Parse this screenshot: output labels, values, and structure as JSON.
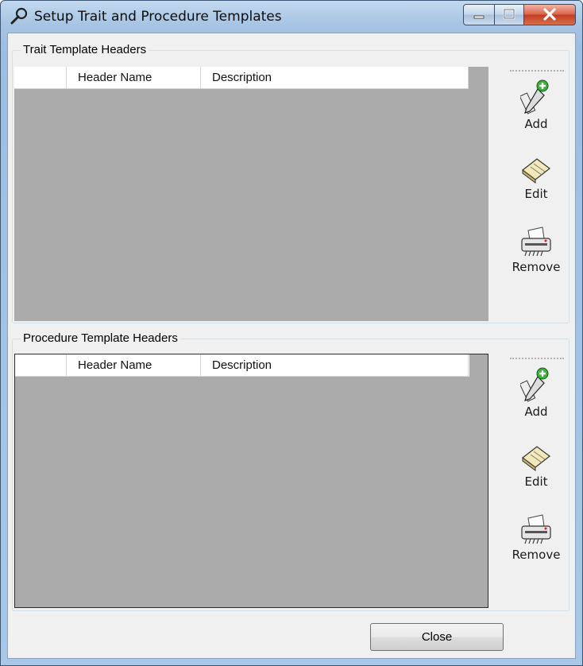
{
  "window": {
    "title": "Setup Trait and Procedure Templates",
    "icons": {
      "app": "wrench-icon",
      "minimize": "minimize-icon",
      "maximize": "maximize-icon",
      "close": "close-icon"
    }
  },
  "trait_group": {
    "title": "Trait Template Headers",
    "columns": [
      "",
      "Header Name",
      "Description"
    ],
    "rows": [],
    "toolbar": {
      "add": "Add",
      "edit": "Edit",
      "remove": "Remove"
    }
  },
  "procedure_group": {
    "title": "Procedure Template Headers",
    "columns": [
      "",
      "Header Name",
      "Description"
    ],
    "rows": [],
    "toolbar": {
      "add": "Add",
      "edit": "Edit",
      "remove": "Remove"
    }
  },
  "footer": {
    "close_label": "Close"
  },
  "colors": {
    "grid_empty": "#ababab",
    "client_bg": "#f0f0f0",
    "titlebar": "#a7c4e3",
    "close_control": "#c23b22"
  }
}
